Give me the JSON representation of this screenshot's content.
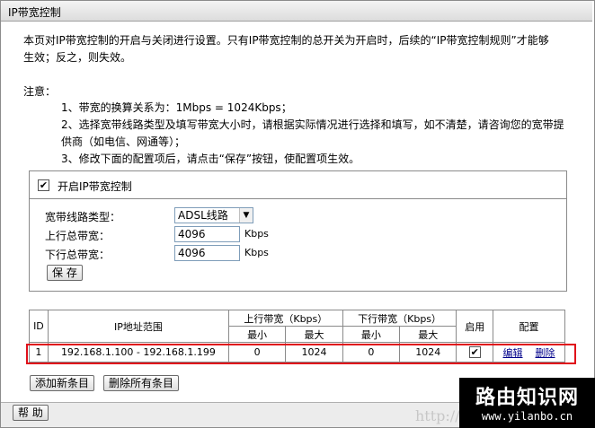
{
  "header": {
    "title": "IP带宽控制"
  },
  "intro": {
    "line1": "本页对IP带宽控制的开启与关闭进行设置。只有IP带宽控制的总开关为开启时，后续的“IP带宽控制规则”才能够",
    "line2": "生效；反之，则失效。"
  },
  "notes": {
    "title": "注意：",
    "items": [
      "1、带宽的换算关系为：1Mbps = 1024Kbps；",
      "2、选择宽带线路类型及填写带宽大小时，请根据实际情况进行选择和填写，如不清楚，请咨询您的宽带提",
      "供商（如电信、网通等）；",
      "3、修改下面的配置项后，请点击“保存”按钮，使配置项生效。"
    ]
  },
  "settings": {
    "enable_label": "开启IP带宽控制",
    "enable_checked": true,
    "line_type_label": "宽带线路类型：",
    "line_type_value": "ADSL线路",
    "up_label": "上行总带宽：",
    "up_value": "4096",
    "up_unit": "Kbps",
    "down_label": "下行总带宽：",
    "down_value": "4096",
    "down_unit": "Kbps",
    "save_label": "保 存"
  },
  "table": {
    "headers": {
      "id": "ID",
      "ip_range": "IP地址范围",
      "up": "上行带宽（Kbps）",
      "down": "下行带宽（Kbps）",
      "min": "最小",
      "max": "最大",
      "enable": "启用",
      "config": "配置"
    },
    "rows": [
      {
        "id": "1",
        "ip_range": "192.168.1.100 - 192.168.1.199",
        "up_min": "0",
        "up_max": "1024",
        "down_min": "0",
        "down_max": "1024",
        "enabled": true,
        "edit": "编辑",
        "delete": "删除"
      }
    ]
  },
  "actions": {
    "add_label": "添加新条目",
    "delete_all_label": "删除所有条目"
  },
  "footer": {
    "help_label": "帮 助"
  },
  "watermark": {
    "url_partial": "http://",
    "title": "路由知识网",
    "site": "www.yilanbo.cn"
  }
}
